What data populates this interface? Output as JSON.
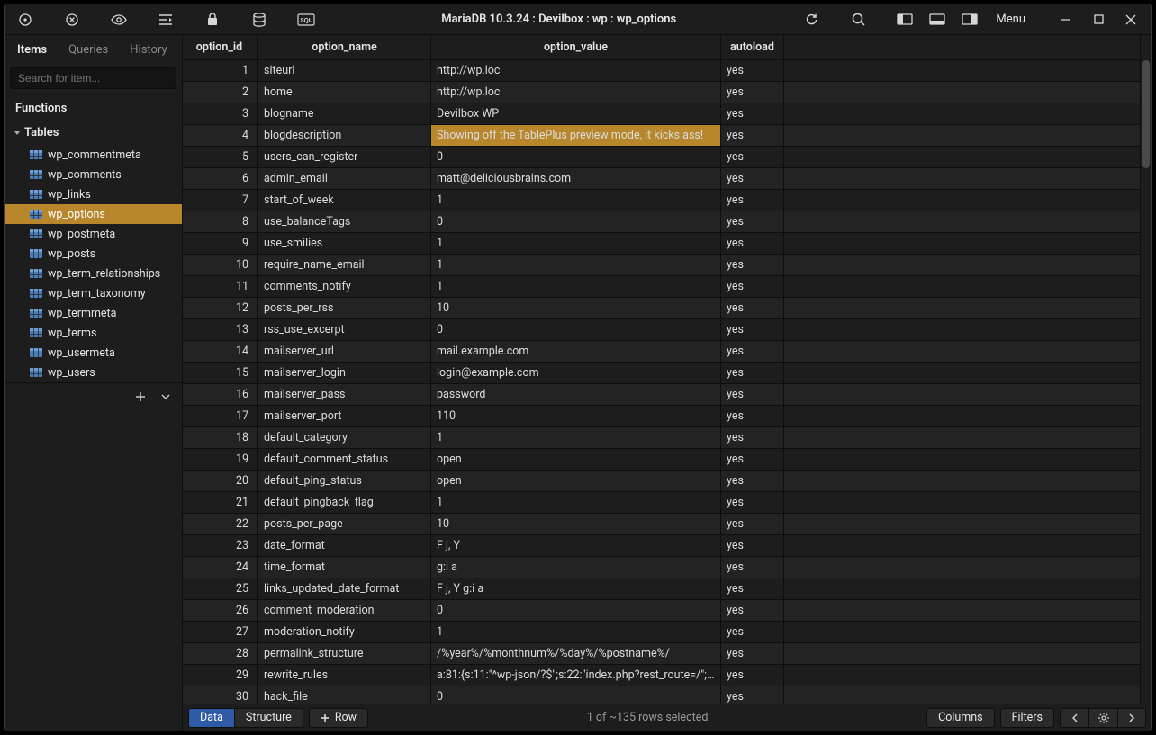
{
  "window": {
    "title": "MariaDB 10.3.24 : Devilbox : wp : wp_options",
    "menu_label": "Menu"
  },
  "sidebar": {
    "tabs": {
      "items": "Items",
      "queries": "Queries",
      "history": "History"
    },
    "search_placeholder": "Search for item...",
    "functions_label": "Functions",
    "tables_label": "Tables",
    "tables": [
      "wp_commentmeta",
      "wp_comments",
      "wp_links",
      "wp_options",
      "wp_postmeta",
      "wp_posts",
      "wp_term_relationships",
      "wp_term_taxonomy",
      "wp_termmeta",
      "wp_terms",
      "wp_usermeta",
      "wp_users"
    ],
    "selected_table": "wp_options"
  },
  "columns": [
    "option_id",
    "option_name",
    "option_value",
    "autoload"
  ],
  "rows": [
    {
      "id": "1",
      "name": "siteurl",
      "value": "http://wp.loc",
      "auto": "yes"
    },
    {
      "id": "2",
      "name": "home",
      "value": "http://wp.loc",
      "auto": "yes"
    },
    {
      "id": "3",
      "name": "blogname",
      "value": "Devilbox WP",
      "auto": "yes"
    },
    {
      "id": "4",
      "name": "blogdescription",
      "value": "Showing off the TablePlus preview mode, it kicks ass!",
      "auto": "yes",
      "edited": true
    },
    {
      "id": "5",
      "name": "users_can_register",
      "value": "0",
      "auto": "yes"
    },
    {
      "id": "6",
      "name": "admin_email",
      "value": "matt@deliciousbrains.com",
      "auto": "yes"
    },
    {
      "id": "7",
      "name": "start_of_week",
      "value": "1",
      "auto": "yes"
    },
    {
      "id": "8",
      "name": "use_balanceTags",
      "value": "0",
      "auto": "yes"
    },
    {
      "id": "9",
      "name": "use_smilies",
      "value": "1",
      "auto": "yes"
    },
    {
      "id": "10",
      "name": "require_name_email",
      "value": "1",
      "auto": "yes"
    },
    {
      "id": "11",
      "name": "comments_notify",
      "value": "1",
      "auto": "yes"
    },
    {
      "id": "12",
      "name": "posts_per_rss",
      "value": "10",
      "auto": "yes"
    },
    {
      "id": "13",
      "name": "rss_use_excerpt",
      "value": "0",
      "auto": "yes"
    },
    {
      "id": "14",
      "name": "mailserver_url",
      "value": "mail.example.com",
      "auto": "yes"
    },
    {
      "id": "15",
      "name": "mailserver_login",
      "value": "login@example.com",
      "auto": "yes"
    },
    {
      "id": "16",
      "name": "mailserver_pass",
      "value": "password",
      "auto": "yes"
    },
    {
      "id": "17",
      "name": "mailserver_port",
      "value": "110",
      "auto": "yes"
    },
    {
      "id": "18",
      "name": "default_category",
      "value": "1",
      "auto": "yes"
    },
    {
      "id": "19",
      "name": "default_comment_status",
      "value": "open",
      "auto": "yes"
    },
    {
      "id": "20",
      "name": "default_ping_status",
      "value": "open",
      "auto": "yes"
    },
    {
      "id": "21",
      "name": "default_pingback_flag",
      "value": "1",
      "auto": "yes"
    },
    {
      "id": "22",
      "name": "posts_per_page",
      "value": "10",
      "auto": "yes"
    },
    {
      "id": "23",
      "name": "date_format",
      "value": "F j, Y",
      "auto": "yes"
    },
    {
      "id": "24",
      "name": "time_format",
      "value": "g:i a",
      "auto": "yes"
    },
    {
      "id": "25",
      "name": "links_updated_date_format",
      "value": "F j, Y g:i a",
      "auto": "yes"
    },
    {
      "id": "26",
      "name": "comment_moderation",
      "value": "0",
      "auto": "yes"
    },
    {
      "id": "27",
      "name": "moderation_notify",
      "value": "1",
      "auto": "yes"
    },
    {
      "id": "28",
      "name": "permalink_structure",
      "value": "/%year%/%monthnum%/%day%/%postname%/",
      "auto": "yes"
    },
    {
      "id": "29",
      "name": "rewrite_rules",
      "value": "a:81:{s:11:\"^wp-json/?$\";s:22:\"index.php?rest_route=/\";s:...",
      "auto": "yes"
    },
    {
      "id": "30",
      "name": "hack_file",
      "value": "0",
      "auto": "yes"
    }
  ],
  "footer": {
    "data": "Data",
    "structure": "Structure",
    "row": "Row",
    "status": "1 of ~135 rows selected",
    "columns": "Columns",
    "filters": "Filters"
  }
}
